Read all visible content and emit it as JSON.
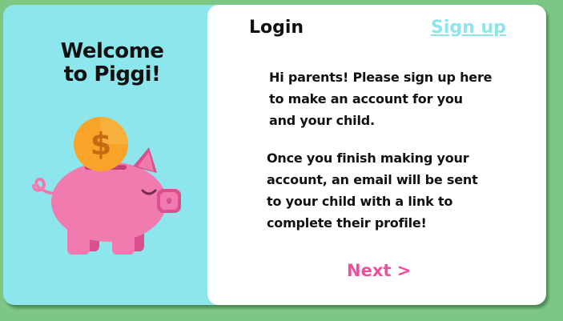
{
  "colors": {
    "background": "#7dc785",
    "left_panel": "#8de6ec",
    "right_panel": "#ffffff",
    "accent_pink": "#ec4f9c",
    "signup_link": "#8de6ec",
    "coin": "#f8a429",
    "pig": "#f17bae"
  },
  "left_panel": {
    "welcome_line1": "Welcome",
    "welcome_line2": "to Piggi!",
    "illustration_icon": "piggy-bank-with-dollar-coin"
  },
  "tabs": {
    "login_label": "Login",
    "signup_label": "Sign up"
  },
  "content": {
    "paragraph1_lines": [
      "Hi parents! Please sign up here",
      "to make an account for you",
      "and your child."
    ],
    "paragraph2_lines": [
      "Once you finish making your",
      "account, an email will be sent",
      "to your child with a link to",
      "complete their profile!"
    ]
  },
  "actions": {
    "next_label": "Next >"
  }
}
